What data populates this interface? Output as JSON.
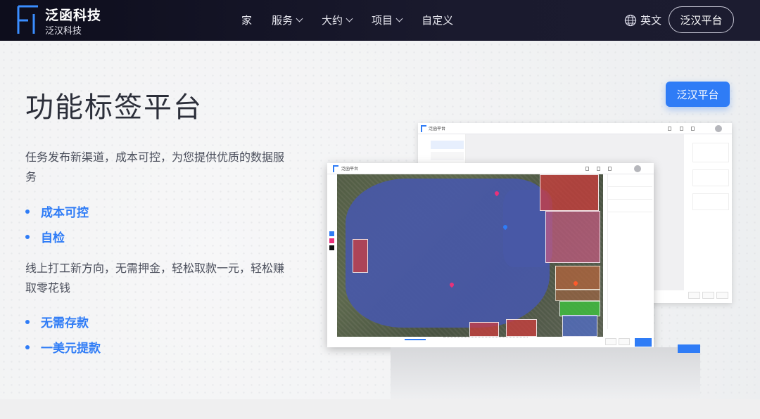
{
  "brand": {
    "title": "泛函科技",
    "subtitle": "泛汉科技"
  },
  "nav": {
    "items": [
      {
        "label": "家",
        "dropdown": false
      },
      {
        "label": "服务",
        "dropdown": true
      },
      {
        "label": "大约",
        "dropdown": true
      },
      {
        "label": "项目",
        "dropdown": true
      },
      {
        "label": "自定义",
        "dropdown": false
      }
    ],
    "language": "英文",
    "platform_button": "泛汉平台"
  },
  "hero": {
    "title": "功能标签平台",
    "cta": "泛汉平台",
    "paragraph1": "任务发布新渠道，成本可控，为您提供优质的数据服务",
    "bullets1": [
      "成本可控",
      "自检"
    ],
    "paragraph2": "线上打工新方向，无需押金，轻松取款一元，轻松赚取零花钱",
    "bullets2": [
      "无需存款",
      "一美元提款"
    ]
  },
  "mockup": {
    "brand": "泛函平台",
    "colors": {
      "accent": "#2f7cf6",
      "lake": "#4858a8",
      "red": "#d23c3c",
      "pink": "#c85a82",
      "green": "#3cc83c"
    },
    "swatches": [
      "#2f7cf6",
      "#e8317a",
      "#111111"
    ]
  }
}
